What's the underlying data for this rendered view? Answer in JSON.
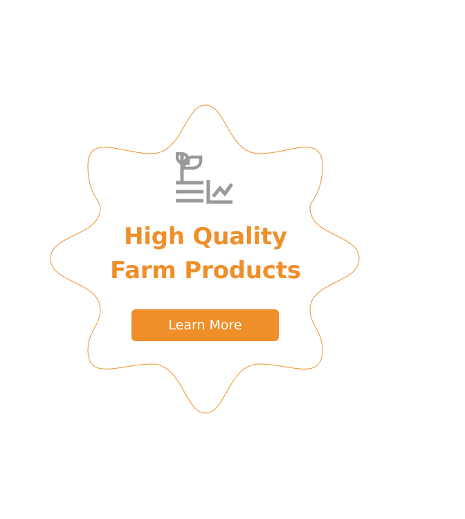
{
  "badge": {
    "title_line1": "High Quality",
    "title_line2": "Farm Products",
    "button_label": "Learn More",
    "icon": "plant-growth-chart-icon"
  },
  "colors": {
    "accent": "#EE8F2A",
    "icon_gray": "#999999",
    "background": "#FFFFFF"
  }
}
